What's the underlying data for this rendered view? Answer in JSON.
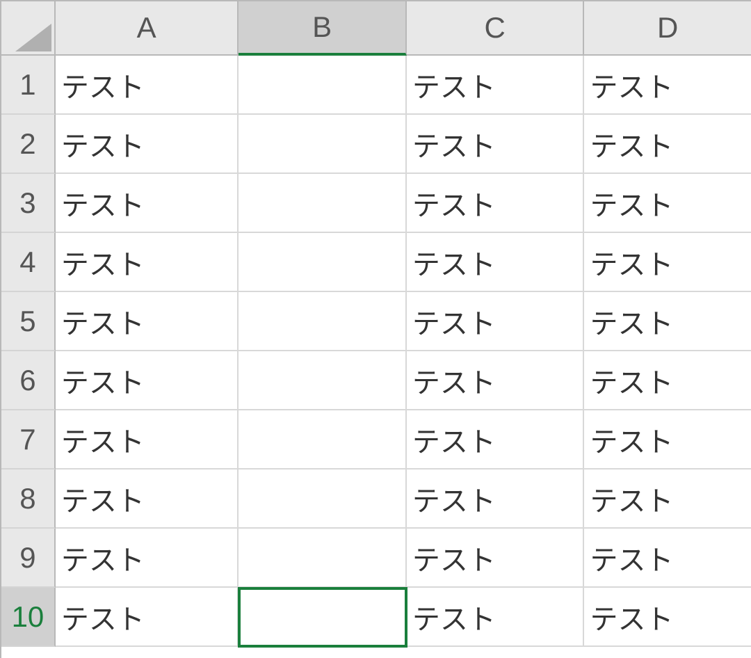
{
  "columns": [
    "A",
    "B",
    "C",
    "D"
  ],
  "selectedColumnIndex": 1,
  "selectedRowIndex": 9,
  "activeCell": {
    "row": 9,
    "col": 1
  },
  "rows": [
    {
      "num": "1",
      "cells": [
        "テスト",
        "",
        "テスト",
        "テスト"
      ]
    },
    {
      "num": "2",
      "cells": [
        "テスト",
        "",
        "テスト",
        "テスト"
      ]
    },
    {
      "num": "3",
      "cells": [
        "テスト",
        "",
        "テスト",
        "テスト"
      ]
    },
    {
      "num": "4",
      "cells": [
        "テスト",
        "",
        "テスト",
        "テスト"
      ]
    },
    {
      "num": "5",
      "cells": [
        "テスト",
        "",
        "テスト",
        "テスト"
      ]
    },
    {
      "num": "6",
      "cells": [
        "テスト",
        "",
        "テスト",
        "テスト"
      ]
    },
    {
      "num": "7",
      "cells": [
        "テスト",
        "",
        "テスト",
        "テスト"
      ]
    },
    {
      "num": "8",
      "cells": [
        "テスト",
        "",
        "テスト",
        "テスト"
      ]
    },
    {
      "num": "9",
      "cells": [
        "テスト",
        "",
        "テスト",
        "テスト"
      ]
    },
    {
      "num": "10",
      "cells": [
        "テスト",
        "",
        "テスト",
        "テスト"
      ]
    }
  ]
}
